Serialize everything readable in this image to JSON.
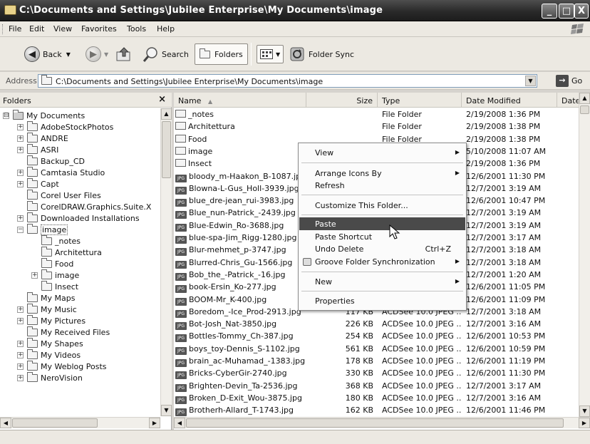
{
  "window": {
    "title": "C:\\Documents and Settings\\Jubilee Enterprise\\My Documents\\image",
    "controls": {
      "minimize": "_",
      "maximize": "□",
      "close": "X"
    }
  },
  "menubar": {
    "items": [
      "File",
      "Edit",
      "View",
      "Favorites",
      "Tools",
      "Help"
    ]
  },
  "toolbar": {
    "back_label": "Back",
    "search_label": "Search",
    "folders_label": "Folders",
    "folder_sync_label": "Folder Sync"
  },
  "address": {
    "label": "Address",
    "value": "C:\\Documents and Settings\\Jubilee Enterprise\\My Documents\\image",
    "go_label": "Go"
  },
  "folders_pane": {
    "title": "Folders",
    "close": "×",
    "tree": [
      {
        "label": "My Documents",
        "expander": "⊟",
        "level": 0
      },
      {
        "label": "AdobeStockPhotos",
        "expander": "+",
        "level": 1
      },
      {
        "label": "ANDRE",
        "expander": "+",
        "level": 1
      },
      {
        "label": "ASRI",
        "expander": "+",
        "level": 1
      },
      {
        "label": "Backup_CD",
        "expander": "",
        "level": 1
      },
      {
        "label": "Camtasia Studio",
        "expander": "+",
        "level": 1
      },
      {
        "label": "Capt",
        "expander": "+",
        "level": 1
      },
      {
        "label": "Corel User Files",
        "expander": "",
        "level": 1
      },
      {
        "label": "CorelDRAW.Graphics.Suite.X",
        "expander": "",
        "level": 1
      },
      {
        "label": "Downloaded Installations",
        "expander": "+",
        "level": 1
      },
      {
        "label": "image",
        "expander": "−",
        "level": 1,
        "selected": true
      },
      {
        "label": "_notes",
        "expander": "",
        "level": 2
      },
      {
        "label": "Architettura",
        "expander": "",
        "level": 2
      },
      {
        "label": "Food",
        "expander": "",
        "level": 2
      },
      {
        "label": "image",
        "expander": "+",
        "level": 2
      },
      {
        "label": "Insect",
        "expander": "",
        "level": 2
      },
      {
        "label": "My Maps",
        "expander": "",
        "level": 1
      },
      {
        "label": "My Music",
        "expander": "+",
        "level": 1
      },
      {
        "label": "My Pictures",
        "expander": "+",
        "level": 1
      },
      {
        "label": "My Received Files",
        "expander": "",
        "level": 1
      },
      {
        "label": "My Shapes",
        "expander": "+",
        "level": 1
      },
      {
        "label": "My Videos",
        "expander": "+",
        "level": 1
      },
      {
        "label": "My Weblog Posts",
        "expander": "+",
        "level": 1
      },
      {
        "label": "NeroVision",
        "expander": "+",
        "level": 1
      }
    ]
  },
  "file_list": {
    "columns": [
      "Name",
      "Size",
      "Type",
      "Date Modified",
      "Date P"
    ],
    "rows": [
      {
        "name": "_notes",
        "size": "",
        "type": "File Folder",
        "date": "2/19/2008 1:36 PM",
        "folder": true
      },
      {
        "name": "Architettura",
        "size": "",
        "type": "File Folder",
        "date": "2/19/2008 1:38 PM",
        "folder": true
      },
      {
        "name": "Food",
        "size": "",
        "type": "File Folder",
        "date": "2/19/2008 1:38 PM",
        "folder": true
      },
      {
        "name": "image",
        "size": "",
        "type": "",
        "date": "5/10/2008 11:07 AM",
        "folder": true
      },
      {
        "name": "Insect",
        "size": "",
        "type": "",
        "date": "2/19/2008 1:36 PM",
        "folder": true
      },
      {
        "name": "bloody_m-Haakon_B-1087.jpg",
        "size": "",
        "type": "",
        "date": "12/6/2001 11:30 PM"
      },
      {
        "name": "Blowna-L-Gus_Holl-3939.jpg",
        "size": "",
        "type": "",
        "date": "12/7/2001 3:19 AM"
      },
      {
        "name": "blue_dre-jean_rui-3983.jpg",
        "size": "",
        "type": "",
        "date": "12/6/2001 10:47 PM"
      },
      {
        "name": "Blue_nun-Patrick_-2439.jpg",
        "size": "",
        "type": "",
        "date": "12/7/2001 3:19 AM"
      },
      {
        "name": "Blue-Edwin_Ro-3688.jpg",
        "size": "",
        "type": "",
        "date": "12/7/2001 3:19 AM"
      },
      {
        "name": "blue-spa-Jim_Rigg-1280.jpg",
        "size": "",
        "type": "",
        "date": "12/7/2001 3:17 AM"
      },
      {
        "name": "Blur-mehmet_p-3747.jpg",
        "size": "",
        "type": "",
        "date": "12/7/2001 3:18 AM"
      },
      {
        "name": "Blurred-Chris_Gu-1566.jpg",
        "size": "",
        "type": "",
        "date": "12/7/2001 3:18 AM"
      },
      {
        "name": "Bob_the_-Patrick_-16.jpg",
        "size": "",
        "type": "",
        "date": "12/7/2001 1:20 AM"
      },
      {
        "name": "book-Ersin_Ko-277.jpg",
        "size": "",
        "type": "",
        "date": "12/6/2001 11:05 PM"
      },
      {
        "name": "BOOM-Mr_K-400.jpg",
        "size": "",
        "type": "",
        "date": "12/6/2001 11:09 PM"
      },
      {
        "name": "Boredom_-Ice_Prod-2913.jpg",
        "size": "117 KB",
        "type": "ACDSee 10.0 JPEG ...",
        "date": "12/7/2001 3:18 AM"
      },
      {
        "name": "Bot-Josh_Nat-3850.jpg",
        "size": "226 KB",
        "type": "ACDSee 10.0 JPEG ...",
        "date": "12/7/2001 3:16 AM"
      },
      {
        "name": "Bottles-Tommy_Ch-387.jpg",
        "size": "254 KB",
        "type": "ACDSee 10.0 JPEG ...",
        "date": "12/6/2001 10:53 PM"
      },
      {
        "name": "boys_toy-Dennis_S-1102.jpg",
        "size": "561 KB",
        "type": "ACDSee 10.0 JPEG ...",
        "date": "12/6/2001 10:59 PM"
      },
      {
        "name": "brain_ac-Muhamad_-1383.jpg",
        "size": "178 KB",
        "type": "ACDSee 10.0 JPEG ...",
        "date": "12/6/2001 11:19 PM"
      },
      {
        "name": "Bricks-CyberGir-2740.jpg",
        "size": "330 KB",
        "type": "ACDSee 10.0 JPEG ...",
        "date": "12/6/2001 11:30 PM"
      },
      {
        "name": "Brighten-Devin_Ta-2536.jpg",
        "size": "368 KB",
        "type": "ACDSee 10.0 JPEG ...",
        "date": "12/7/2001 3:17 AM"
      },
      {
        "name": "Broken_D-Exit_Wou-3875.jpg",
        "size": "180 KB",
        "type": "ACDSee 10.0 JPEG ...",
        "date": "12/7/2001 3:16 AM"
      },
      {
        "name": "Brotherh-Allard_T-1743.jpg",
        "size": "162 KB",
        "type": "ACDSee 10.0 JPEG ...",
        "date": "12/6/2001 11:46 PM"
      }
    ]
  },
  "context_menu": {
    "view": "View",
    "arrange": "Arrange Icons By",
    "refresh": "Refresh",
    "customize": "Customize This Folder...",
    "paste": "Paste",
    "paste_shortcut": "Paste Shortcut",
    "undo_delete": "Undo Delete",
    "undo_shortcut": "Ctrl+Z",
    "groove": "Groove Folder Synchronization",
    "new": "New",
    "properties": "Properties"
  },
  "icons": {
    "back": "back-arrow-icon",
    "forward": "forward-arrow-icon",
    "up": "folder-up-icon",
    "search": "search-icon",
    "folders": "folders-icon",
    "views": "views-icon",
    "sync": "folder-sync-icon",
    "go": "go-arrow-icon"
  },
  "colors": {
    "highlight": "#4a4a4a",
    "titlebar": "#2a2a2a"
  }
}
